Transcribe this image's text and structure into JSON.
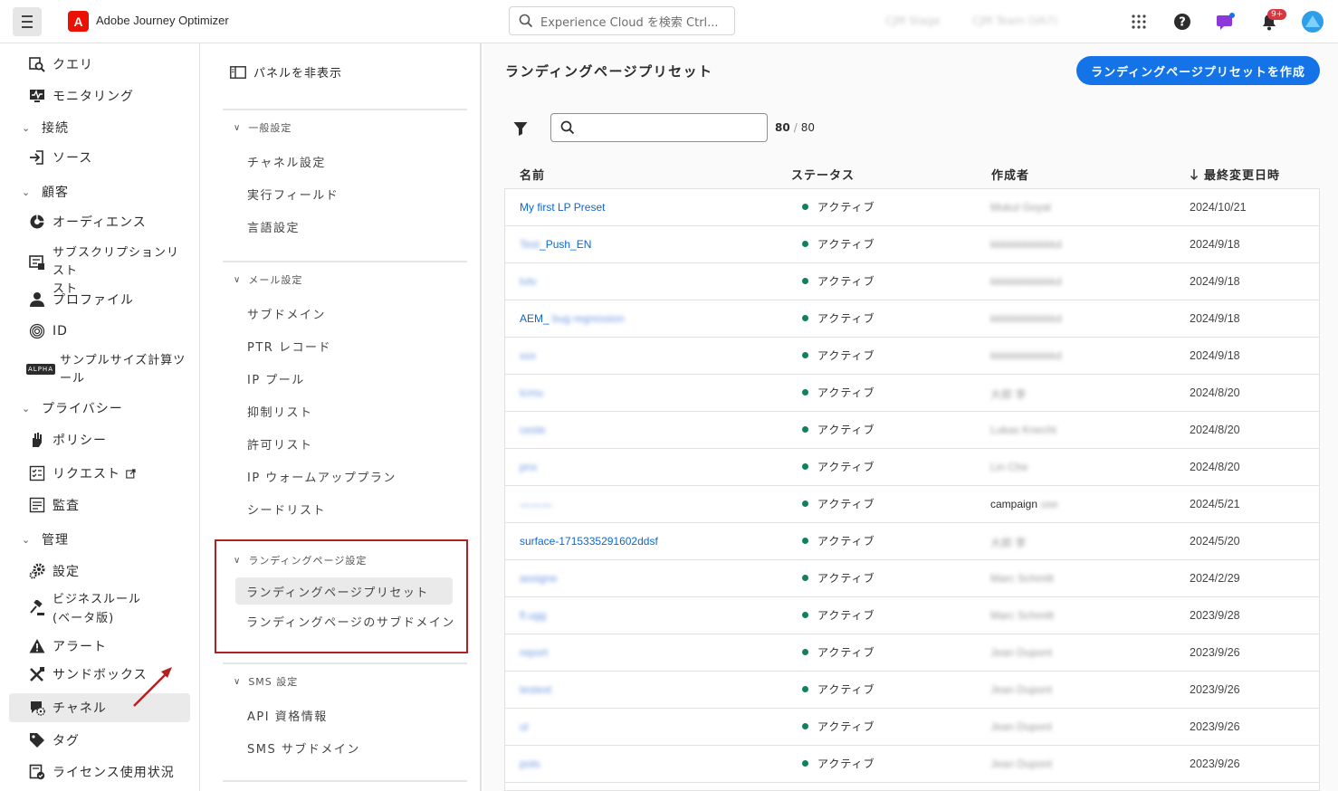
{
  "topbar": {
    "app_name": "Adobe Journey Optimizer",
    "search_placeholder": "Experience Cloud を検索 Ctrl...",
    "org_name": "CJM Stage",
    "sandbox_name": "CJM Team (VA7)",
    "notifications_badge": "9+"
  },
  "leftnav": {
    "items": [
      {
        "label": "クエリ",
        "icon": "query-icon"
      },
      {
        "label": "モニタリング",
        "icon": "monitoring-icon"
      },
      {
        "section": "接続"
      },
      {
        "label": "ソース",
        "icon": "sources-icon"
      },
      {
        "section": "顧客"
      },
      {
        "label": "オーディエンス",
        "icon": "audiences-icon"
      },
      {
        "label": "サブスクリプションリスト",
        "label2": "スト",
        "icon": "subscription-list-icon"
      },
      {
        "label": "プロファイル",
        "icon": "profile-icon"
      },
      {
        "label": "ID",
        "icon": "identity-icon"
      },
      {
        "label": "サンプルサイズ計算ツ",
        "label2": "ール",
        "icon": "alpha-badge"
      },
      {
        "section": "プライバシー"
      },
      {
        "label": "ポリシー",
        "icon": "policy-icon"
      },
      {
        "label": "リクエスト",
        "icon": "request-icon"
      },
      {
        "label": "監査",
        "icon": "audit-icon"
      },
      {
        "section": "管理"
      },
      {
        "label": "設定",
        "icon": "settings-icon"
      },
      {
        "label": "ビジネスルール",
        "label2": "(ベータ版)",
        "icon": "business-rules-icon"
      },
      {
        "label": "アラート",
        "icon": "alert-icon"
      },
      {
        "label": "サンドボックス",
        "icon": "sandbox-icon"
      },
      {
        "label": "チャネル",
        "icon": "channel-icon"
      },
      {
        "label": "タグ",
        "icon": "tag-icon"
      },
      {
        "label": "ライセンス使用状況",
        "icon": "license-icon"
      }
    ],
    "alpha_badge": "ALPHA"
  },
  "midnav": {
    "hide_panel": "パネルを非表示",
    "groups": [
      {
        "title": "一般設定",
        "items": [
          "チャネル設定",
          "実行フィールド",
          "言語設定"
        ]
      },
      {
        "title": "メール設定",
        "items": [
          "サブドメイン",
          "PTR レコード",
          "IP プール",
          "抑制リスト",
          "許可リスト",
          "IP ウォームアッププラン",
          "シードリスト"
        ]
      },
      {
        "title": "ランディングページ設定",
        "items": [
          "ランディングページプリセット",
          "ランディングページのサブドメイン"
        ]
      },
      {
        "title": "SMS 設定",
        "items": [
          "API 資格情報",
          "SMS サブドメイン"
        ]
      }
    ]
  },
  "main": {
    "title": "ランディングページプリセット",
    "create_button": "ランディングページプリセットを作成",
    "count_shown": "80",
    "count_total": "80",
    "columns": [
      "名前",
      "ステータス",
      "作成者",
      "最終変更日時"
    ],
    "rows": [
      {
        "name": "My first LP Preset",
        "status": "アクティブ",
        "author": "Mukul Goyal",
        "date": "2024/10/21"
      },
      {
        "name": "Test_Push_EN",
        "status": "アクティブ",
        "author": "kkkkkkkkkkkkd",
        "date": "2024/9/18"
      },
      {
        "name": "tvtv",
        "status": "アクティブ",
        "author": "kkkkkkkkkkkkd",
        "date": "2024/9/18"
      },
      {
        "name": "AEM_ bug regression",
        "status": "アクティブ",
        "author": "kkkkkkkkkkkkd",
        "date": "2024/9/18"
      },
      {
        "name": "xxx",
        "status": "アクティブ",
        "author": "kkkkkkkkkkkkd",
        "date": "2024/9/18"
      },
      {
        "name": "tcmu",
        "status": "アクティブ",
        "author": "大郎 李",
        "date": "2024/8/20"
      },
      {
        "name": "ceste",
        "status": "アクティブ",
        "author": "Lukas Knecht",
        "date": "2024/8/20"
      },
      {
        "name": "pnx",
        "status": "アクティブ",
        "author": "Lin Che",
        "date": "2024/8/20"
      },
      {
        "name": "一一一",
        "status": "アクティブ",
        "author": "campaign",
        "author_extra": "use",
        "date": "2024/5/21"
      },
      {
        "name": "surface-1715335291602ddsf",
        "status": "アクティブ",
        "author": "大郎 李",
        "date": "2024/5/20"
      },
      {
        "name": "assigne",
        "status": "アクティブ",
        "author": "Marc Schmitt",
        "date": "2024/2/29"
      },
      {
        "name": "fl.ugg",
        "status": "アクティブ",
        "author": "Marc Schmitt",
        "date": "2023/9/28"
      },
      {
        "name": "report",
        "status": "アクティブ",
        "author": "Jean Dupont",
        "date": "2023/9/26"
      },
      {
        "name": "testext",
        "status": "アクティブ",
        "author": "Jean Dupont",
        "date": "2023/9/26"
      },
      {
        "name": "ul",
        "status": "アクティブ",
        "author": "Jean Dupont",
        "date": "2023/9/26"
      },
      {
        "name": "pots",
        "status": "アクティブ",
        "author": "Jean Dupont",
        "date": "2023/9/26"
      }
    ]
  },
  "colors": {
    "accent": "#1473e6",
    "active": "#12805c",
    "highlight_box": "#b22222",
    "link": "#0d66d0"
  }
}
